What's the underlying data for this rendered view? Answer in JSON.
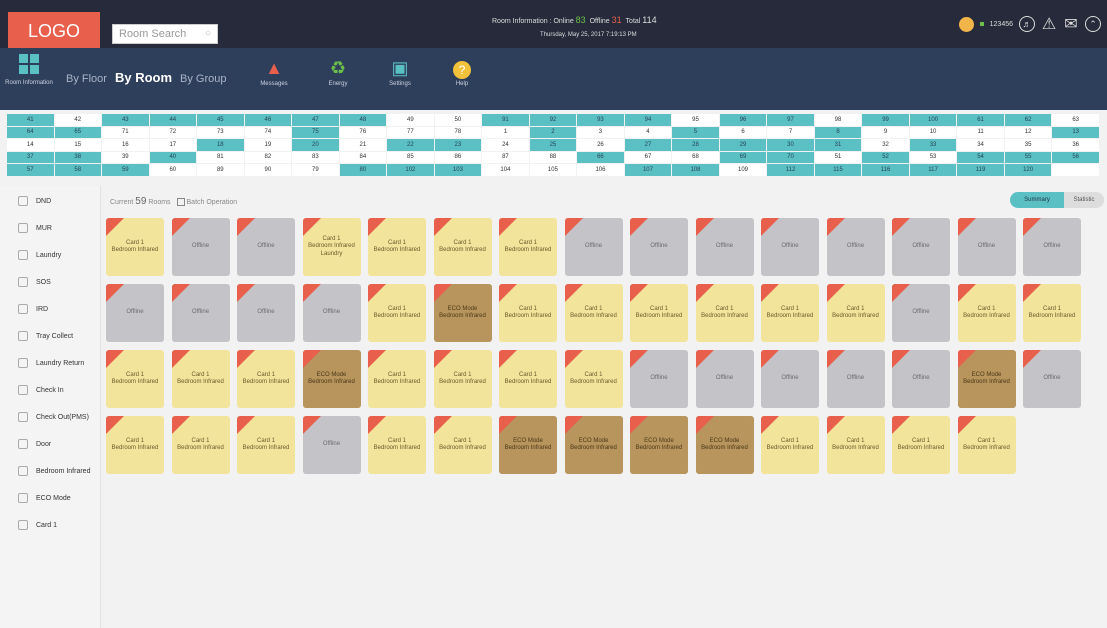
{
  "header": {
    "logo": "LOGO",
    "search_placeholder": "Room Search",
    "room_info": {
      "label": "Room Information :",
      "online_label": "Online",
      "online": "83",
      "offline_label": "Offline",
      "offline": "31",
      "total_label": "Total",
      "total": "114",
      "datetime": "Thursday, May 25, 2017 7:19:13 PM"
    },
    "user": "123456"
  },
  "nav": {
    "room_information": "Room Information",
    "view_tabs": [
      "By Floor",
      "By Room",
      "By Group"
    ],
    "items": [
      {
        "label": "Messages",
        "icon": "siren-icon"
      },
      {
        "label": "Energy",
        "icon": "recycle-icon"
      },
      {
        "label": "Settings",
        "icon": "monitor-icon"
      },
      {
        "label": "Help",
        "icon": "help-icon"
      }
    ]
  },
  "room_grid": [
    [
      [
        "41",
        1
      ],
      [
        "42",
        0
      ],
      [
        "43",
        1
      ],
      [
        "44",
        1
      ],
      [
        "45",
        1
      ],
      [
        "46",
        1
      ],
      [
        "47",
        1
      ],
      [
        "48",
        1
      ],
      [
        "49",
        0
      ],
      [
        "50",
        0
      ],
      [
        "91",
        1
      ],
      [
        "92",
        1
      ],
      [
        "93",
        1
      ],
      [
        "94",
        1
      ],
      [
        "95",
        0
      ],
      [
        "96",
        1
      ],
      [
        "97",
        1
      ],
      [
        "98",
        0
      ],
      [
        "99",
        1
      ],
      [
        "100",
        1
      ],
      [
        "61",
        1
      ],
      [
        "62",
        1
      ],
      [
        "63",
        0
      ]
    ],
    [
      [
        "64",
        1
      ],
      [
        "65",
        1
      ],
      [
        "71",
        0
      ],
      [
        "72",
        0
      ],
      [
        "73",
        0
      ],
      [
        "74",
        0
      ],
      [
        "75",
        1
      ],
      [
        "76",
        0
      ],
      [
        "77",
        0
      ],
      [
        "78",
        0
      ],
      [
        "1",
        0
      ],
      [
        "2",
        1
      ],
      [
        "3",
        0
      ],
      [
        "4",
        0
      ],
      [
        "5",
        1
      ],
      [
        "6",
        0
      ],
      [
        "7",
        0
      ],
      [
        "8",
        1
      ],
      [
        "9",
        0
      ],
      [
        "10",
        0
      ],
      [
        "11",
        0
      ],
      [
        "12",
        0
      ],
      [
        "13",
        1
      ]
    ],
    [
      [
        "14",
        0
      ],
      [
        "15",
        0
      ],
      [
        "16",
        0
      ],
      [
        "17",
        0
      ],
      [
        "18",
        1
      ],
      [
        "19",
        0
      ],
      [
        "20",
        1
      ],
      [
        "21",
        0
      ],
      [
        "22",
        1
      ],
      [
        "23",
        1
      ],
      [
        "24",
        0
      ],
      [
        "25",
        1
      ],
      [
        "26",
        0
      ],
      [
        "27",
        1
      ],
      [
        "28",
        1
      ],
      [
        "29",
        1
      ],
      [
        "30",
        1
      ],
      [
        "31",
        1
      ],
      [
        "32",
        0
      ],
      [
        "33",
        1
      ],
      [
        "34",
        0
      ],
      [
        "35",
        0
      ],
      [
        "36",
        0
      ]
    ],
    [
      [
        "37",
        1
      ],
      [
        "38",
        1
      ],
      [
        "39",
        0
      ],
      [
        "40",
        1
      ],
      [
        "81",
        0
      ],
      [
        "82",
        0
      ],
      [
        "83",
        0
      ],
      [
        "84",
        0
      ],
      [
        "85",
        0
      ],
      [
        "86",
        0
      ],
      [
        "87",
        0
      ],
      [
        "88",
        0
      ],
      [
        "66",
        1
      ],
      [
        "67",
        0
      ],
      [
        "68",
        0
      ],
      [
        "69",
        1
      ],
      [
        "70",
        1
      ],
      [
        "51",
        0
      ],
      [
        "52",
        1
      ],
      [
        "53",
        0
      ],
      [
        "54",
        1
      ],
      [
        "55",
        1
      ],
      [
        "56",
        1
      ]
    ],
    [
      [
        "57",
        1
      ],
      [
        "58",
        1
      ],
      [
        "59",
        1
      ],
      [
        "60",
        0
      ],
      [
        "89",
        0
      ],
      [
        "90",
        0
      ],
      [
        "79",
        0
      ],
      [
        "80",
        1
      ],
      [
        "102",
        1
      ],
      [
        "103",
        1
      ],
      [
        "104",
        0
      ],
      [
        "105",
        0
      ],
      [
        "106",
        0
      ],
      [
        "107",
        1
      ],
      [
        "108",
        1
      ],
      [
        "109",
        0
      ],
      [
        "112",
        1
      ],
      [
        "115",
        1
      ],
      [
        "116",
        1
      ],
      [
        "117",
        1
      ],
      [
        "119",
        1
      ],
      [
        "120",
        1
      ],
      [
        "",
        0
      ]
    ]
  ],
  "legend": [
    {
      "label": "DND",
      "icon": "dnd-icon"
    },
    {
      "label": "MUR",
      "icon": "broom-icon"
    },
    {
      "label": "Laundry",
      "icon": "laundry-icon"
    },
    {
      "label": "SOS",
      "icon": "sos-icon"
    },
    {
      "label": "IRD",
      "icon": "food-icon"
    },
    {
      "label": "Tray Collect",
      "icon": "tray-icon"
    },
    {
      "label": "Laundry Return",
      "icon": "laundry-return-icon"
    },
    {
      "label": "Check In",
      "icon": "check-in-icon"
    },
    {
      "label": "Check Out(PMS)",
      "icon": "check-out-icon"
    },
    {
      "label": "Door",
      "icon": "door-icon"
    },
    {
      "label": "Bedroom Infrared",
      "icon": "infrared-icon"
    },
    {
      "label": "ECO Mode",
      "icon": "eco-icon"
    },
    {
      "label": "Card 1",
      "icon": "card-icon"
    }
  ],
  "main": {
    "current_label": "Current",
    "count": "59",
    "rooms_label": "Rooms",
    "batch_label": "Batch Operation",
    "summary_label": "Summary",
    "statistic_label": "Statistic"
  },
  "tiles": [
    [
      {
        "s": "yellow",
        "l": [
          "Card 1",
          "Bedroom Infrared"
        ]
      },
      {
        "s": "gray",
        "l": [
          "Offline"
        ]
      },
      {
        "s": "gray",
        "l": [
          "Offline"
        ]
      },
      {
        "s": "yellow",
        "l": [
          "Card 1",
          "Bedroom Infrared",
          "Laundry"
        ]
      },
      {
        "s": "yellow",
        "l": [
          "Card 1",
          "Bedroom Infrared"
        ]
      },
      {
        "s": "yellow",
        "l": [
          "Card 1",
          "Bedroom Infrared"
        ]
      },
      {
        "s": "yellow",
        "l": [
          "Card 1",
          "Bedroom Infrared"
        ]
      },
      {
        "s": "gray",
        "l": [
          "Offline"
        ]
      },
      {
        "s": "gray",
        "l": [
          "Offline"
        ]
      },
      {
        "s": "gray",
        "l": [
          "Offline"
        ]
      },
      {
        "s": "gray",
        "l": [
          "Offline"
        ]
      },
      {
        "s": "gray",
        "l": [
          "Offline"
        ]
      },
      {
        "s": "gray",
        "l": [
          "Offline"
        ]
      },
      {
        "s": "gray",
        "l": [
          "Offline"
        ]
      },
      {
        "s": "gray",
        "l": [
          "Offline"
        ]
      }
    ],
    [
      {
        "s": "gray",
        "l": [
          "Offline"
        ]
      },
      {
        "s": "gray",
        "l": [
          "Offline"
        ]
      },
      {
        "s": "gray",
        "l": [
          "Offline"
        ]
      },
      {
        "s": "gray",
        "l": [
          "Offline"
        ]
      },
      {
        "s": "yellow",
        "l": [
          "Card 1",
          "Bedroom Infrared"
        ]
      },
      {
        "s": "brown",
        "l": [
          "ECO Mode",
          "Bedroom Infrared"
        ]
      },
      {
        "s": "yellow",
        "l": [
          "Card 1",
          "Bedroom Infrared"
        ]
      },
      {
        "s": "yellow",
        "l": [
          "Card 1",
          "Bedroom Infrared"
        ]
      },
      {
        "s": "yellow",
        "l": [
          "Card 1",
          "Bedroom Infrared"
        ]
      },
      {
        "s": "yellow",
        "l": [
          "Card 1",
          "Bedroom Infrared"
        ]
      },
      {
        "s": "yellow",
        "l": [
          "Card 1",
          "Bedroom Infrared"
        ]
      },
      {
        "s": "yellow",
        "l": [
          "Card 1",
          "Bedroom Infrared"
        ]
      },
      {
        "s": "gray",
        "l": [
          "Offline"
        ]
      },
      {
        "s": "yellow",
        "l": [
          "Card 1",
          "Bedroom Infrared"
        ]
      },
      {
        "s": "yellow",
        "l": [
          "Card 1",
          "Bedroom Infrared"
        ]
      }
    ],
    [
      {
        "s": "yellow",
        "l": [
          "Card 1",
          "Bedroom Infrared"
        ]
      },
      {
        "s": "yellow",
        "l": [
          "Card 1",
          "Bedroom Infrared"
        ]
      },
      {
        "s": "yellow",
        "l": [
          "Card 1",
          "Bedroom Infrared"
        ]
      },
      {
        "s": "brown",
        "l": [
          "ECO Mode",
          "Bedroom Infrared"
        ]
      },
      {
        "s": "yellow",
        "l": [
          "Card 1",
          "Bedroom Infrared"
        ]
      },
      {
        "s": "yellow",
        "l": [
          "Card 1",
          "Bedroom Infrared"
        ]
      },
      {
        "s": "yellow",
        "l": [
          "Card 1",
          "Bedroom Infrared"
        ]
      },
      {
        "s": "yellow",
        "l": [
          "Card 1",
          "Bedroom Infrared"
        ]
      },
      {
        "s": "gray",
        "l": [
          "Offline"
        ]
      },
      {
        "s": "gray",
        "l": [
          "Offline"
        ]
      },
      {
        "s": "gray",
        "l": [
          "Offline"
        ]
      },
      {
        "s": "gray",
        "l": [
          "Offline"
        ]
      },
      {
        "s": "gray",
        "l": [
          "Offline"
        ]
      },
      {
        "s": "brown",
        "l": [
          "ECO Mode",
          "Bedroom Infrared"
        ]
      },
      {
        "s": "gray",
        "l": [
          "Offline"
        ]
      }
    ],
    [
      {
        "s": "yellow",
        "l": [
          "Card 1",
          "Bedroom Infrared"
        ]
      },
      {
        "s": "yellow",
        "l": [
          "Card 1",
          "Bedroom Infrared"
        ]
      },
      {
        "s": "yellow",
        "l": [
          "Card 1",
          "Bedroom Infrared"
        ]
      },
      {
        "s": "gray",
        "l": [
          "Offline"
        ]
      },
      {
        "s": "yellow",
        "l": [
          "Card 1",
          "Bedroom Infrared"
        ]
      },
      {
        "s": "yellow",
        "l": [
          "Card 1",
          "Bedroom Infrared"
        ]
      },
      {
        "s": "brown",
        "l": [
          "ECO Mode",
          "Bedroom Infrared"
        ]
      },
      {
        "s": "brown",
        "l": [
          "ECO Mode",
          "Bedroom Infrared"
        ]
      },
      {
        "s": "brown",
        "l": [
          "ECO Mode",
          "Bedroom Infrared"
        ]
      },
      {
        "s": "brown",
        "l": [
          "ECO Mode",
          "Bedroom Infrared"
        ]
      },
      {
        "s": "yellow",
        "l": [
          "Card 1",
          "Bedroom Infrared"
        ]
      },
      {
        "s": "yellow",
        "l": [
          "Card 1",
          "Bedroom Infrared"
        ]
      },
      {
        "s": "yellow",
        "l": [
          "Card 1",
          "Bedroom Infrared"
        ]
      },
      {
        "s": "yellow",
        "l": [
          "Card 1",
          "Bedroom Infrared"
        ]
      }
    ]
  ]
}
